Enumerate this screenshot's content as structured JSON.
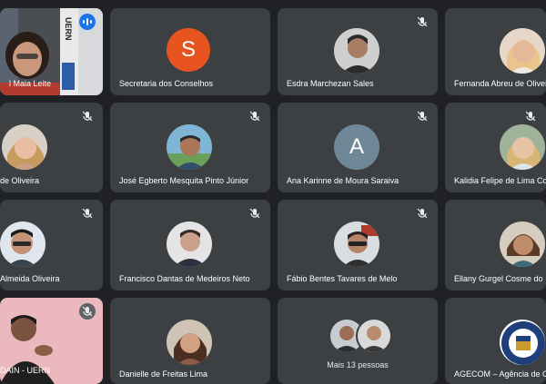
{
  "participants": [
    {
      "name": "l Maia Leite",
      "type": "video",
      "speaking": true
    },
    {
      "name": "Secretaria dos Conselhos",
      "type": "letter",
      "letter": "S",
      "color": "#e8541f"
    },
    {
      "name": "Esdra Marchezan Sales",
      "type": "photo",
      "muted": true
    },
    {
      "name": "Fernanda Abreu de Olivei",
      "type": "photo"
    },
    {
      "name": "de Oliveira",
      "type": "photo",
      "muted": true
    },
    {
      "name": "José Egberto Mesquita Pinto Júnior",
      "type": "photo",
      "muted": true
    },
    {
      "name": "Ana Karinne de Moura Saraiva",
      "type": "letter",
      "letter": "A",
      "color": "#6f8796",
      "muted": true
    },
    {
      "name": "Kalidia Felipe de Lima Co",
      "type": "photo",
      "muted": true
    },
    {
      "name": "Almeida Oliveira",
      "type": "photo",
      "muted": true
    },
    {
      "name": "Francisco Dantas de Medeiros Neto",
      "type": "photo",
      "muted": true
    },
    {
      "name": "Fábio Bentes Tavares de Melo",
      "type": "photo",
      "muted": true
    },
    {
      "name": "Ellany Gurgel Cosme do",
      "type": "photo"
    },
    {
      "name": "DAIN - UERN",
      "type": "video",
      "muted": true
    },
    {
      "name": "Danielle de Freitas Lima",
      "type": "photo"
    },
    {
      "name": "Mais 13 pessoas",
      "type": "group"
    },
    {
      "name": "AGECOM – Agência de C",
      "type": "photo"
    }
  ],
  "video_banner_text": "UERN",
  "colors": {
    "tile": "#3c4043",
    "background": "#202124",
    "accent": "#1a73e8"
  }
}
